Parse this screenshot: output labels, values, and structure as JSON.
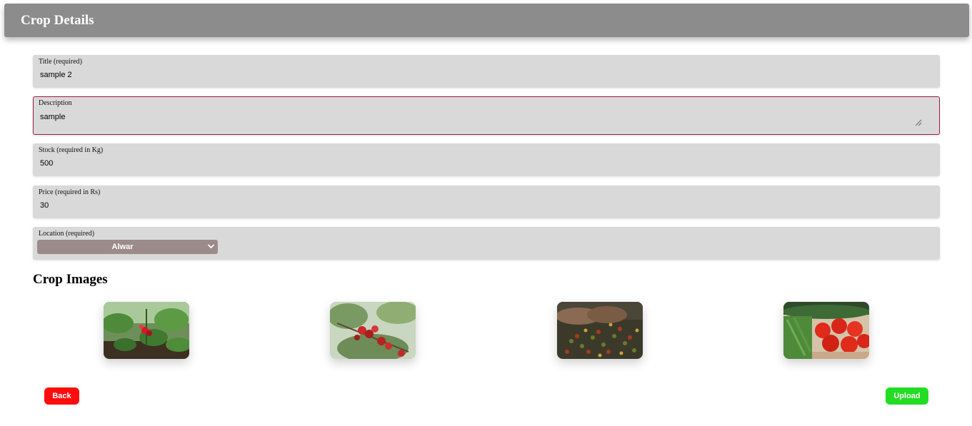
{
  "header": {
    "title": "Crop Details"
  },
  "form": {
    "title_label": "Title (required)",
    "title_value": "sample 2",
    "description_label": "Description",
    "description_value": "sample",
    "stock_label": "Stock (required in Kg)",
    "stock_value": "500",
    "price_label": "Price (required in Rs)",
    "price_value": "30",
    "location_label": "Location (required)",
    "location_value": "Alwar"
  },
  "images": {
    "title": "Crop Images",
    "items": [
      "strawberry-plant-image",
      "red-berries-tree-image",
      "coffee-beans-hands-image",
      "tomatoes-vegetables-image"
    ]
  },
  "actions": {
    "back_label": "Back",
    "upload_label": "Upload"
  },
  "colors": {
    "header_bg": "#8c8c8c",
    "field_bg": "#d9d9d9",
    "focus_border": "#a0184a",
    "select_bg": "#9c8b8b",
    "back_button": "#ff0d0d",
    "upload_button": "#22dd22"
  }
}
